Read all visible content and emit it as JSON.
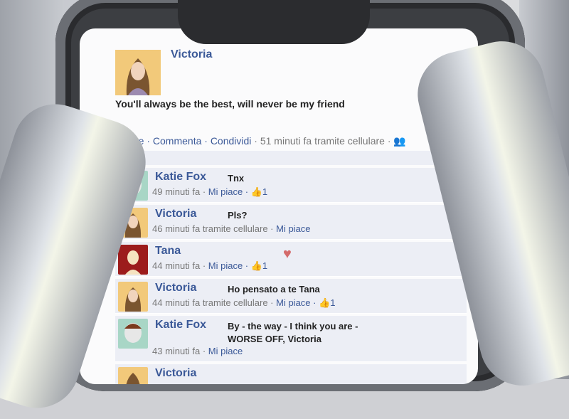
{
  "post": {
    "author": "Victoria",
    "text": "You'll always be the best, will never be my friend",
    "actions": "i piace · Commenta · Condividi",
    "meta": " · 51 minuti fa tramite cellulare · "
  },
  "comments": [
    {
      "name": "Katie Fox",
      "text": "Tnx",
      "time": "49 minuti fa · ",
      "like": "Mi piace",
      "count": " · 👍1"
    },
    {
      "name": "Victoria",
      "text": "Pls?",
      "time": "46 minuti fa tramite cellulare · ",
      "like": "Mi piace",
      "count": ""
    },
    {
      "name": "Tana",
      "text": "",
      "time": "44 minuti fa · ",
      "like": "Mi piace",
      "count": " · 👍1"
    },
    {
      "name": "Victoria",
      "text": "Ho pensato a te Tana",
      "time": "44 minuti fa tramite cellulare · ",
      "like": "Mi piace",
      "count": " · 👍1"
    },
    {
      "name": "Katie Fox",
      "text": "By - the way - I think you are - WORSE OFF, Victoria",
      "time": "43 minuti fa · ",
      "like": "Mi piace",
      "count": ""
    },
    {
      "name": "Victoria",
      "text": "",
      "time": "",
      "like": "",
      "count": ""
    }
  ],
  "icons": {
    "heart": "heart-icon",
    "thumb": "thumbs-up-icon"
  }
}
